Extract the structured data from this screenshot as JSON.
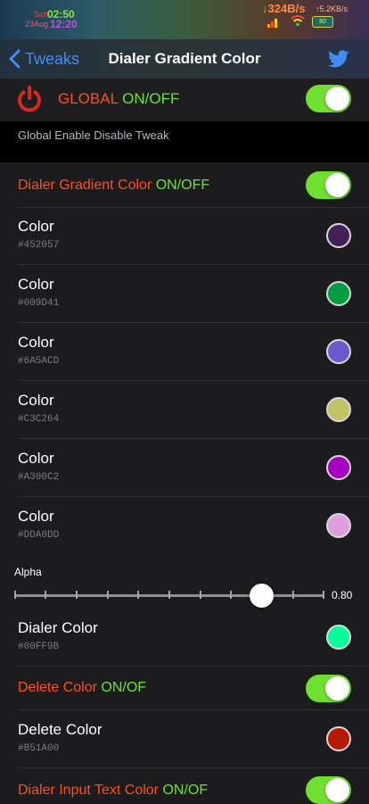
{
  "status_bar": {
    "day": "Sun",
    "time_top": "02:50",
    "date": "23Aug",
    "time_bottom": "12:20",
    "download": "↓324B/s",
    "upload": "↑5.2KB/s",
    "battery": "80"
  },
  "nav": {
    "back_label": "Tweaks",
    "title": "Dialer Gradient Color",
    "share_icon": "twitter-icon"
  },
  "global": {
    "label_part1": "GLOBAL ",
    "label_part2": "ON/OFF",
    "enabled": true,
    "footer": "Global Enable Disable Tweak"
  },
  "gradient_toggle": {
    "label_part1": "Dialer Gradient Color ",
    "label_part2": "ON/OFF",
    "enabled": true
  },
  "gradient_colors": [
    {
      "title": "Color",
      "hex": "#452057",
      "swatch": "#452057"
    },
    {
      "title": "Color",
      "hex": "#009D41",
      "swatch": "#009D41"
    },
    {
      "title": "Color",
      "hex": "#6A5ACD",
      "swatch": "#6A5ACD"
    },
    {
      "title": "Color",
      "hex": "#C3C264",
      "swatch": "#C3C264"
    },
    {
      "title": "Color",
      "hex": "#A300C2",
      "swatch": "#A300C2"
    },
    {
      "title": "Color",
      "hex": "#DDA0DD",
      "swatch": "#DDA0DD"
    }
  ],
  "alpha": {
    "label": "Alpha",
    "value": 0.8,
    "value_text": "0.80"
  },
  "dialer_color": {
    "title": "Dialer Color",
    "hex": "#00FF9B",
    "swatch": "#00FF9B"
  },
  "delete_toggle": {
    "label_part1": "Delete Color ",
    "label_part2": "ON/OF",
    "enabled": true
  },
  "delete_color": {
    "title": "Delete Color",
    "hex": "#B51A00",
    "swatch": "#B51A00"
  },
  "input_text_toggle": {
    "label_part1": "Dialer Input Text Color ",
    "label_part2": "ON/OF",
    "enabled": true
  },
  "colors": {
    "accent_blue": "#3f8ef5",
    "toggle_on": "#6fe030",
    "label_red": "#ff4f1e",
    "label_green": "#6ee237"
  }
}
